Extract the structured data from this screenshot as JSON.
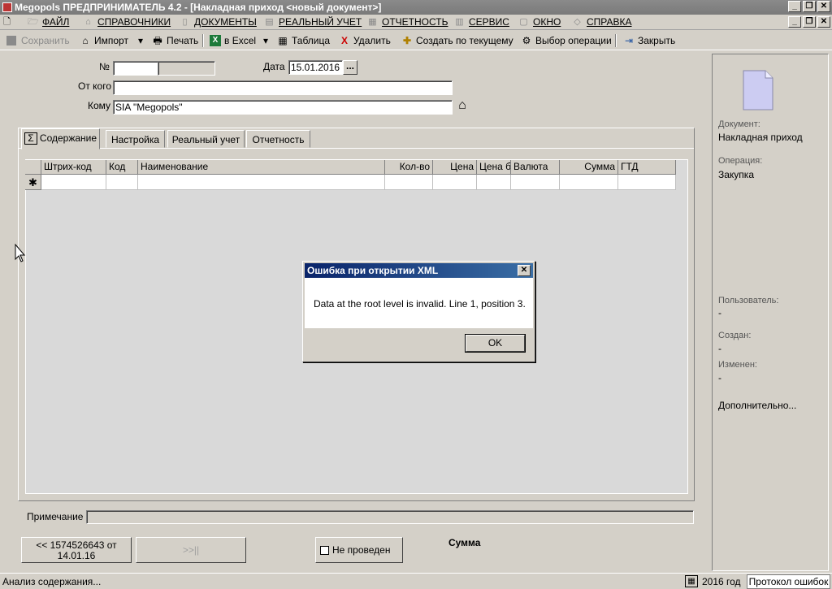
{
  "window": {
    "title": "Megopols  ПРЕДПРИНИМАТЕЛЬ 4.2 - [Накладная приход <новый документ>]"
  },
  "menubar": {
    "items": [
      {
        "label": "ФАЙЛ",
        "icon": "file-icon"
      },
      {
        "label": "СПРАВОЧНИКИ",
        "icon": "home-icon"
      },
      {
        "label": "ДОКУМЕНТЫ",
        "icon": "document-icon"
      },
      {
        "label": "РЕАЛЬНЫЙ УЧЕТ",
        "icon": "ledger-icon"
      },
      {
        "label": "ОТЧЕТНОСТЬ",
        "icon": "report-icon"
      },
      {
        "label": "СЕРВИС",
        "icon": "calculator-icon"
      },
      {
        "label": "ОКНО",
        "icon": "window-icon"
      },
      {
        "label": "СПРАВКА",
        "icon": "help-icon"
      }
    ]
  },
  "toolbar": {
    "save": "Сохранить",
    "import": "Импорт",
    "print": "Печать",
    "excel": "в Excel",
    "table": "Таблица",
    "delete": "Удалить",
    "create_from_current": "Создать по текущему",
    "select_operation": "Выбор операции",
    "close": "Закрыть"
  },
  "form": {
    "number_label": "№",
    "number_value": "",
    "date_label": "Дата",
    "date_value": "15.01.2016",
    "date_button": "...",
    "from_label": "От кого",
    "from_value": "",
    "to_label": "Кому",
    "to_value": "SIA \"Megopols\""
  },
  "tabs": [
    {
      "label": "Содержание",
      "active": true
    },
    {
      "label": "Настройка",
      "active": false
    },
    {
      "label": "Реальный учет",
      "active": false
    },
    {
      "label": "Отчетность",
      "active": false
    }
  ],
  "grid": {
    "columns": [
      "Штрих-код",
      "Код",
      "Наименование",
      "Кол-во",
      "Цена",
      "Цена б",
      "Валюта",
      "Сумма",
      "ГТД"
    ],
    "new_row_marker": "✱"
  },
  "dialog": {
    "title": "Ошибка при открытии XML",
    "message": "Data at the root level is invalid. Line 1, position 3.",
    "ok_label": "OK",
    "close_glyph": "✕"
  },
  "note_label": "Примечание",
  "note_value": "",
  "nav": {
    "prev_label_line1": "<< 1574526643 от",
    "prev_label_line2": "14.01.16",
    "next_label": ">>||"
  },
  "status_toggle": {
    "label": "Не проведен",
    "checked": false
  },
  "sum_label": "Сумма",
  "sidepanel": {
    "document_label": "Документ:",
    "document_value": "Накладная приход",
    "operation_label": "Операция:",
    "operation_value": "Закупка",
    "user_label": "Пользователь:",
    "user_value": "-",
    "created_label": "Создан:",
    "created_value": "-",
    "modified_label": "Изменен:",
    "modified_value": "-",
    "more_label": "Дополнительно..."
  },
  "statusbar": {
    "message": "Анализ содержания...",
    "year": "2016 год",
    "error_log": "Протокол ошибок"
  }
}
